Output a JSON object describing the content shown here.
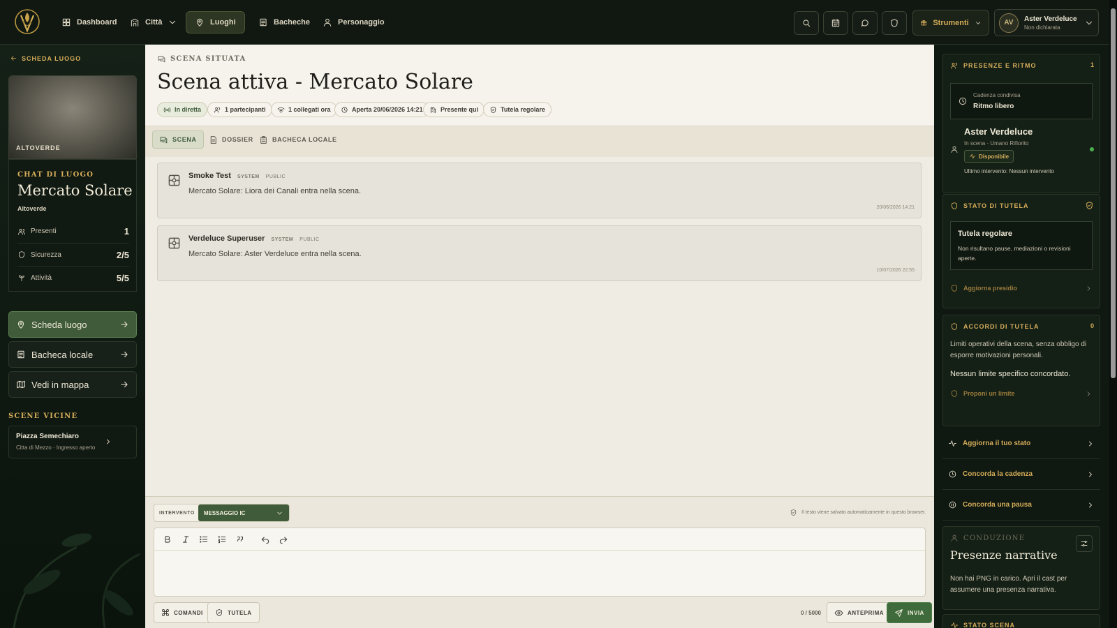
{
  "topbar": {
    "nav": [
      {
        "label": "Dashboard",
        "icon": "grid-icon"
      },
      {
        "label": "Città",
        "icon": "building-icon"
      },
      {
        "label": "Luoghi",
        "icon": "map-pin-icon"
      },
      {
        "label": "Bacheche",
        "icon": "board-icon"
      },
      {
        "label": "Personaggio",
        "icon": "user-icon"
      }
    ],
    "tools_label": "Strumenti",
    "user": {
      "initials": "AV",
      "name": "Aster Verdeluce",
      "status": "Non dichiarata"
    }
  },
  "left": {
    "back_label": "SCHEDA LUOGO",
    "image_label": "ALTOVERDE",
    "chat_kicker": "CHAT DI LUOGO",
    "place_name": "Mercato Solare",
    "district": "Altoverde",
    "stats": [
      {
        "label": "Presenti",
        "value": "1"
      },
      {
        "label": "Sicurezza",
        "value": "2/5"
      },
      {
        "label": "Attività",
        "value": "5/5"
      }
    ],
    "buttons": [
      {
        "label": "Scheda luogo"
      },
      {
        "label": "Bacheca locale"
      },
      {
        "label": "Vedi in mappa"
      }
    ],
    "nearby_title": "SCENE VICINE",
    "nearby": {
      "name": "Piazza Semechiaro",
      "sub": "Citta di Mezzo · Ingresso aperto"
    }
  },
  "main": {
    "kicker": "SCENA SITUATA",
    "title": "Scena attiva - Mercato Solare",
    "chips": [
      "In diretta",
      "1  partecipanti",
      "1  collegati ora",
      "Aperta 20/06/2026 14:21",
      "Presente qui",
      "Tutela regolare"
    ],
    "tabs": [
      "SCENA",
      "DOSSIER",
      "BACHECA LOCALE"
    ],
    "messages": [
      {
        "author": "Smoke Test",
        "tag1": "SYSTEM",
        "tag2": "PUBLIC",
        "text": "Mercato Solare: Liora dei Canali entra nella scena.",
        "time": "20/06/2026 14:21"
      },
      {
        "author": "Verdeluce Superuser",
        "tag1": "SYSTEM",
        "tag2": "PUBLIC",
        "text": "Mercato Solare: Aster Verdeluce entra nella scena.",
        "time": "10/07/2026 22:55"
      }
    ],
    "composer": {
      "type_label": "INTERVENTO",
      "type_value": "MESSAGGIO IC",
      "autosave_note": "Il testo viene salvato automaticamente in questo browser.",
      "commands_label": "COMANDI",
      "tutela_label": "TUTELA",
      "counter": "0 / 5000",
      "preview_label": "ANTEPRIMA",
      "send_label": "INVIA"
    }
  },
  "right": {
    "presence": {
      "title": "PRESENZE E RITMO",
      "count": "1",
      "cadence_kicker": "Cadenza condivisa",
      "cadence_value": "Ritmo libero",
      "name": "Aster Verdeluce",
      "sub": "In scena · Umano Rifiorito",
      "badge": "Disponibile",
      "last": "Ultimo intervento: Nessun intervento"
    },
    "tutela": {
      "title": "STATO DI TUTELA",
      "heading": "Tutela regolare",
      "text": "Non risultano pause, mediazioni o revisioni aperte.",
      "link": "Aggiorna presidio"
    },
    "accordi": {
      "title": "ACCORDI DI TUTELA",
      "count": "0",
      "text": "Limiti operativi della scena, senza obbligo di esporre motivazioni personali.",
      "strong": "Nessun limite specifico concordato.",
      "link": "Proponi un limite"
    },
    "links": [
      "Aggiorna il tuo stato",
      "Concorda la cadenza",
      "Concorda una pausa"
    ],
    "conduzione": {
      "kicker": "CONDUZIONE",
      "title": "Presenze narrative",
      "text": "Non hai PNG in carico. Apri il cast per assumere una presenza narrativa."
    },
    "stato_scena": "STATO SCENA"
  }
}
